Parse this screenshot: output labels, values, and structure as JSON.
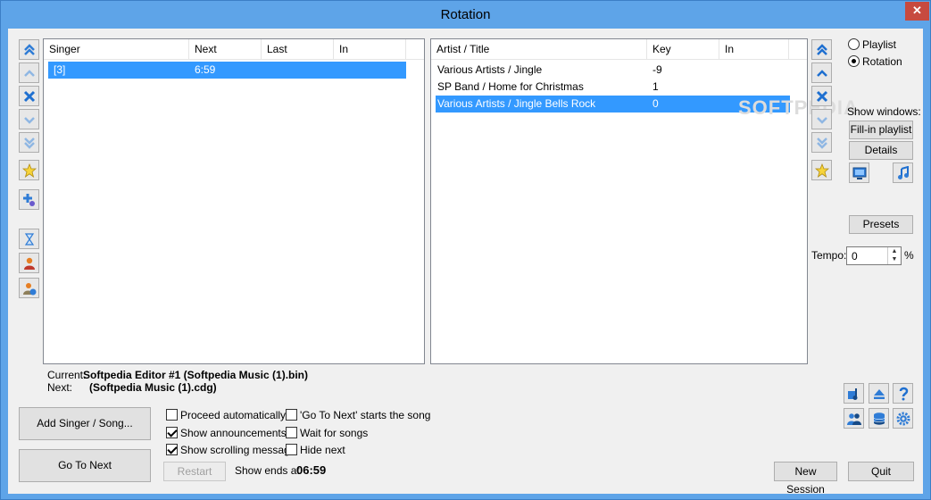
{
  "window": {
    "title": "Rotation",
    "close_glyph": "✕"
  },
  "left_list": {
    "columns": [
      "Singer",
      "Next",
      "Last",
      "In"
    ],
    "rows": [
      {
        "singer": "[3]",
        "next": "6:59",
        "last": "",
        "in": "",
        "selected": true
      }
    ]
  },
  "right_list": {
    "columns": [
      "Artist / Title",
      "Key",
      "In"
    ],
    "rows": [
      {
        "title": "Various Artists / Jingle",
        "key": "-9",
        "in": "",
        "selected": false
      },
      {
        "title": "SP Band / Home for Christmas",
        "key": "1",
        "in": "",
        "selected": false
      },
      {
        "title": "Various Artists / Jingle Bells Rock",
        "key": "0",
        "in": "",
        "selected": true
      }
    ]
  },
  "left_toolbar": [
    "move-top-icon",
    "move-up-icon",
    "remove-icon",
    "move-down-icon",
    "move-bottom-icon",
    "favorite-icon",
    "add-song-icon",
    "hourglass-icon",
    "singer-icon",
    "singer-info-icon"
  ],
  "right_toolbar": [
    "move-top-icon",
    "move-up-icon",
    "remove-icon",
    "move-down-icon",
    "move-bottom-icon",
    "favorite-icon"
  ],
  "view_mode": {
    "options": [
      "Playlist",
      "Rotation"
    ],
    "selected": "Rotation"
  },
  "show_windows": {
    "label": "Show windows:",
    "fill_in_playlist": "Fill-in playlist",
    "details": "Details"
  },
  "presets_label": "Presets",
  "tempo": {
    "label": "Tempo:",
    "value": "0",
    "unit": "%"
  },
  "status": {
    "current_label": "Current:",
    "current_value": "Softpedia Editor #1 (Softpedia Music (1).bin)",
    "next_label": "Next:",
    "next_value": "(Softpedia Music (1).cdg)"
  },
  "buttons": {
    "add_singer_song": "Add Singer / Song...",
    "go_to_next": "Go To Next",
    "restart": "Restart",
    "new_session": "New Session",
    "quit": "Quit"
  },
  "options": [
    {
      "label": "Proceed automatically",
      "checked": false
    },
    {
      "label": "'Go To Next' starts the song",
      "checked": false
    },
    {
      "label": "Show announcements",
      "checked": true
    },
    {
      "label": "Wait for songs",
      "checked": false
    },
    {
      "label": "Show scrolling message",
      "checked": true
    },
    {
      "label": "Hide next",
      "checked": false
    }
  ],
  "show_ends": {
    "label": "Show ends at",
    "time": "06:59"
  },
  "watermark": "SOFTPEDIA",
  "colors": {
    "selection": "#3399ff",
    "title_bar": "#5ea4e8",
    "icon_blue": "#2f7cd6"
  }
}
